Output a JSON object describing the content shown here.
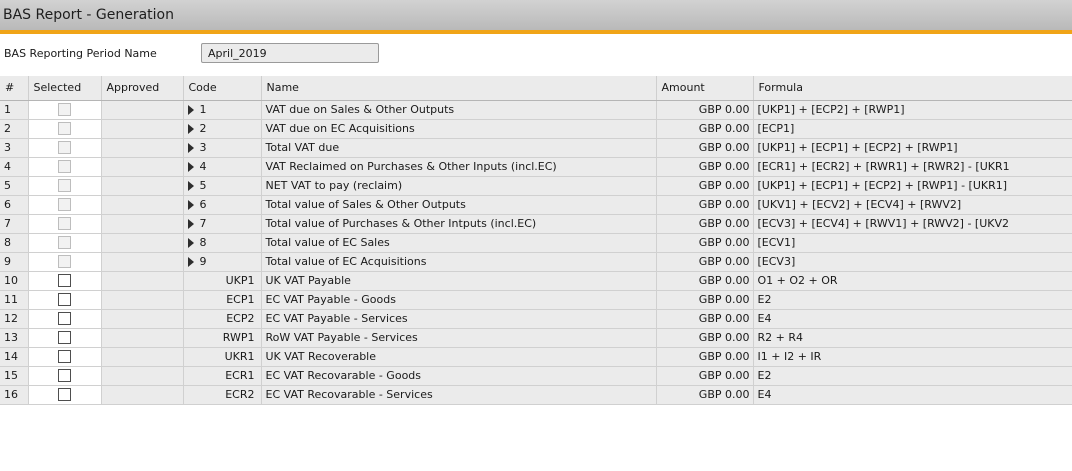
{
  "window": {
    "title": "BAS Report - Generation"
  },
  "period": {
    "label": "BAS Reporting Period Name",
    "value": "April_2019"
  },
  "columns": {
    "num": "#",
    "selected": "Selected",
    "approved": "Approved",
    "code": "Code",
    "name": "Name",
    "amount": "Amount",
    "formula": "Formula"
  },
  "rows": [
    {
      "num": "1",
      "code": "1",
      "name": "VAT due on Sales & Other Outputs",
      "amount": "GBP 0.00",
      "formula": "[UKP1] + [ECP2] + [RWP1]"
    },
    {
      "num": "2",
      "code": "2",
      "name": "VAT due on EC Acquisitions",
      "amount": "GBP 0.00",
      "formula": "[ECP1]"
    },
    {
      "num": "3",
      "code": "3",
      "name": "Total VAT due",
      "amount": "GBP 0.00",
      "formula": "[UKP1] + [ECP1] + [ECP2] + [RWP1]"
    },
    {
      "num": "4",
      "code": "4",
      "name": "VAT Reclaimed on Purchases & Other Inputs (incl.EC)",
      "amount": "GBP 0.00",
      "formula": "[ECR1] + [ECR2] + [RWR1] + [RWR2] - [UKR1"
    },
    {
      "num": "5",
      "code": "5",
      "name": "NET VAT to pay (reclaim)",
      "amount": "GBP 0.00",
      "formula": "[UKP1] + [ECP1] + [ECP2] + [RWP1] - [UKR1]"
    },
    {
      "num": "6",
      "code": "6",
      "name": "Total value of Sales & Other Outputs",
      "amount": "GBP 0.00",
      "formula": "[UKV1] + [ECV2] + [ECV4] + [RWV2]"
    },
    {
      "num": "7",
      "code": "7",
      "name": "Total value of Purchases & Other Intputs (incl.EC)",
      "amount": "GBP 0.00",
      "formula": "[ECV3] + [ECV4] + [RWV1] + [RWV2] - [UKV2"
    },
    {
      "num": "8",
      "code": "8",
      "name": "Total value of EC Sales",
      "amount": "GBP 0.00",
      "formula": "[ECV1]"
    },
    {
      "num": "9",
      "code": "9",
      "name": "Total value of EC Acquisitions",
      "amount": "GBP 0.00",
      "formula": "[ECV3]"
    },
    {
      "num": "10",
      "code": "UKP1",
      "name": "UK VAT Payable",
      "amount": "GBP 0.00",
      "formula": "O1 + O2 + OR"
    },
    {
      "num": "11",
      "code": "ECP1",
      "name": "EC VAT Payable - Goods",
      "amount": "GBP 0.00",
      "formula": "E2"
    },
    {
      "num": "12",
      "code": "ECP2",
      "name": "EC VAT Payable - Services",
      "amount": "GBP 0.00",
      "formula": "E4"
    },
    {
      "num": "13",
      "code": "RWP1",
      "name": "RoW VAT Payable - Services",
      "amount": "GBP 0.00",
      "formula": "R2 + R4"
    },
    {
      "num": "14",
      "code": "UKR1",
      "name": "UK VAT Recoverable",
      "amount": "GBP 0.00",
      "formula": "I1 + I2 + IR"
    },
    {
      "num": "15",
      "code": "ECR1",
      "name": "EC VAT Recovarable - Goods",
      "amount": "GBP 0.00",
      "formula": "E2"
    },
    {
      "num": "16",
      "code": "ECR2",
      "name": "EC VAT Recovarable - Services",
      "amount": "GBP 0.00",
      "formula": "E4"
    }
  ]
}
